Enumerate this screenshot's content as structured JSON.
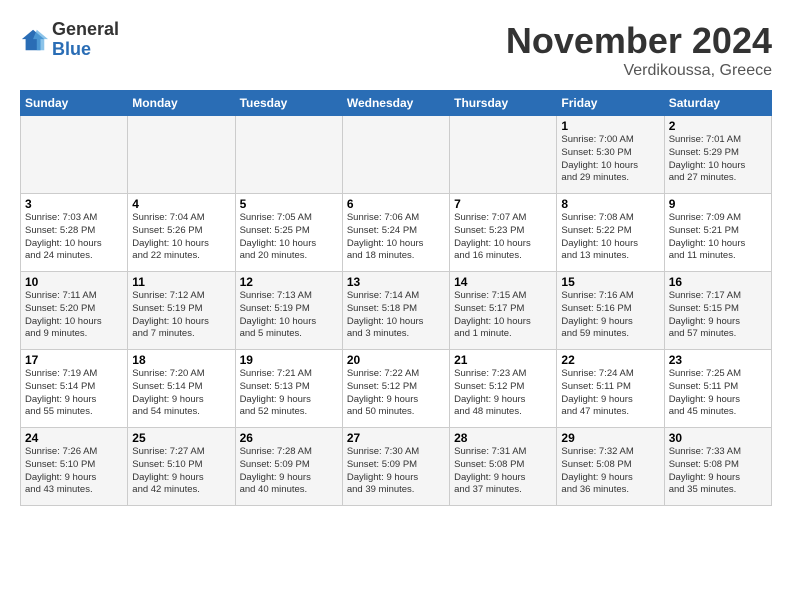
{
  "header": {
    "logo_general": "General",
    "logo_blue": "Blue",
    "month_title": "November 2024",
    "location": "Verdikoussa, Greece"
  },
  "weekdays": [
    "Sunday",
    "Monday",
    "Tuesday",
    "Wednesday",
    "Thursday",
    "Friday",
    "Saturday"
  ],
  "weeks": [
    [
      {
        "day": "",
        "info": ""
      },
      {
        "day": "",
        "info": ""
      },
      {
        "day": "",
        "info": ""
      },
      {
        "day": "",
        "info": ""
      },
      {
        "day": "",
        "info": ""
      },
      {
        "day": "1",
        "info": "Sunrise: 7:00 AM\nSunset: 5:30 PM\nDaylight: 10 hours\nand 29 minutes."
      },
      {
        "day": "2",
        "info": "Sunrise: 7:01 AM\nSunset: 5:29 PM\nDaylight: 10 hours\nand 27 minutes."
      }
    ],
    [
      {
        "day": "3",
        "info": "Sunrise: 7:03 AM\nSunset: 5:28 PM\nDaylight: 10 hours\nand 24 minutes."
      },
      {
        "day": "4",
        "info": "Sunrise: 7:04 AM\nSunset: 5:26 PM\nDaylight: 10 hours\nand 22 minutes."
      },
      {
        "day": "5",
        "info": "Sunrise: 7:05 AM\nSunset: 5:25 PM\nDaylight: 10 hours\nand 20 minutes."
      },
      {
        "day": "6",
        "info": "Sunrise: 7:06 AM\nSunset: 5:24 PM\nDaylight: 10 hours\nand 18 minutes."
      },
      {
        "day": "7",
        "info": "Sunrise: 7:07 AM\nSunset: 5:23 PM\nDaylight: 10 hours\nand 16 minutes."
      },
      {
        "day": "8",
        "info": "Sunrise: 7:08 AM\nSunset: 5:22 PM\nDaylight: 10 hours\nand 13 minutes."
      },
      {
        "day": "9",
        "info": "Sunrise: 7:09 AM\nSunset: 5:21 PM\nDaylight: 10 hours\nand 11 minutes."
      }
    ],
    [
      {
        "day": "10",
        "info": "Sunrise: 7:11 AM\nSunset: 5:20 PM\nDaylight: 10 hours\nand 9 minutes."
      },
      {
        "day": "11",
        "info": "Sunrise: 7:12 AM\nSunset: 5:19 PM\nDaylight: 10 hours\nand 7 minutes."
      },
      {
        "day": "12",
        "info": "Sunrise: 7:13 AM\nSunset: 5:19 PM\nDaylight: 10 hours\nand 5 minutes."
      },
      {
        "day": "13",
        "info": "Sunrise: 7:14 AM\nSunset: 5:18 PM\nDaylight: 10 hours\nand 3 minutes."
      },
      {
        "day": "14",
        "info": "Sunrise: 7:15 AM\nSunset: 5:17 PM\nDaylight: 10 hours\nand 1 minute."
      },
      {
        "day": "15",
        "info": "Sunrise: 7:16 AM\nSunset: 5:16 PM\nDaylight: 9 hours\nand 59 minutes."
      },
      {
        "day": "16",
        "info": "Sunrise: 7:17 AM\nSunset: 5:15 PM\nDaylight: 9 hours\nand 57 minutes."
      }
    ],
    [
      {
        "day": "17",
        "info": "Sunrise: 7:19 AM\nSunset: 5:14 PM\nDaylight: 9 hours\nand 55 minutes."
      },
      {
        "day": "18",
        "info": "Sunrise: 7:20 AM\nSunset: 5:14 PM\nDaylight: 9 hours\nand 54 minutes."
      },
      {
        "day": "19",
        "info": "Sunrise: 7:21 AM\nSunset: 5:13 PM\nDaylight: 9 hours\nand 52 minutes."
      },
      {
        "day": "20",
        "info": "Sunrise: 7:22 AM\nSunset: 5:12 PM\nDaylight: 9 hours\nand 50 minutes."
      },
      {
        "day": "21",
        "info": "Sunrise: 7:23 AM\nSunset: 5:12 PM\nDaylight: 9 hours\nand 48 minutes."
      },
      {
        "day": "22",
        "info": "Sunrise: 7:24 AM\nSunset: 5:11 PM\nDaylight: 9 hours\nand 47 minutes."
      },
      {
        "day": "23",
        "info": "Sunrise: 7:25 AM\nSunset: 5:11 PM\nDaylight: 9 hours\nand 45 minutes."
      }
    ],
    [
      {
        "day": "24",
        "info": "Sunrise: 7:26 AM\nSunset: 5:10 PM\nDaylight: 9 hours\nand 43 minutes."
      },
      {
        "day": "25",
        "info": "Sunrise: 7:27 AM\nSunset: 5:10 PM\nDaylight: 9 hours\nand 42 minutes."
      },
      {
        "day": "26",
        "info": "Sunrise: 7:28 AM\nSunset: 5:09 PM\nDaylight: 9 hours\nand 40 minutes."
      },
      {
        "day": "27",
        "info": "Sunrise: 7:30 AM\nSunset: 5:09 PM\nDaylight: 9 hours\nand 39 minutes."
      },
      {
        "day": "28",
        "info": "Sunrise: 7:31 AM\nSunset: 5:08 PM\nDaylight: 9 hours\nand 37 minutes."
      },
      {
        "day": "29",
        "info": "Sunrise: 7:32 AM\nSunset: 5:08 PM\nDaylight: 9 hours\nand 36 minutes."
      },
      {
        "day": "30",
        "info": "Sunrise: 7:33 AM\nSunset: 5:08 PM\nDaylight: 9 hours\nand 35 minutes."
      }
    ]
  ]
}
